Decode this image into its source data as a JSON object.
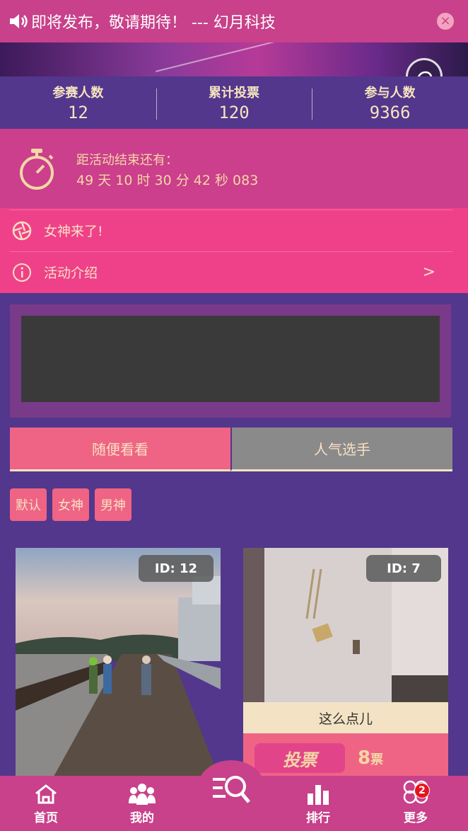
{
  "notice": {
    "text": "即将发布，敬请期待！ --- 幻月科技",
    "icon": "speaker-icon"
  },
  "stats": [
    {
      "label": "参赛人数",
      "value": "12"
    },
    {
      "label": "累计投票",
      "value": "120"
    },
    {
      "label": "参与人数",
      "value": "9366"
    }
  ],
  "countdown": {
    "label": "距活动结束还有：",
    "value": "49 天 10 时 30 分 42 秒 083"
  },
  "menu": [
    {
      "label": "女神来了!",
      "icon": "aperture-icon"
    },
    {
      "label": "活动介绍",
      "icon": "info-icon",
      "arrow": ">"
    }
  ],
  "tabs": [
    {
      "label": "随便看看",
      "active": true
    },
    {
      "label": "人气选手",
      "active": false
    }
  ],
  "filters": [
    "默认",
    "女神",
    "男神"
  ],
  "cards": [
    {
      "id": "ID: 12"
    },
    {
      "id": "ID: 7",
      "caption": "这么点儿",
      "vote_label": "投票",
      "vote_count": "8",
      "vote_unit": "票"
    }
  ],
  "nav": [
    {
      "label": "首页",
      "icon": "home-icon"
    },
    {
      "label": "我的",
      "icon": "people-icon"
    },
    {
      "label": "",
      "icon": "search-list-icon"
    },
    {
      "label": "排行",
      "icon": "bar-chart-icon"
    },
    {
      "label": "更多",
      "icon": "clover-icon",
      "badge": "2"
    }
  ],
  "colors": {
    "primary_pink": "#c8418a",
    "bright_pink": "#ef418a",
    "purple_bg": "#52378c",
    "cream_text": "#f3d7a6"
  }
}
